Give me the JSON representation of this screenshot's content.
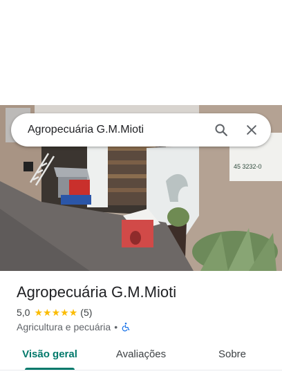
{
  "search": {
    "value": "Agropecuária G.M.Mioti",
    "icons": [
      "search-icon",
      "close-icon"
    ]
  },
  "photo": {
    "sign_text": "45 3232-0"
  },
  "place": {
    "name": "Agropecuária G.M.Mioti",
    "rating": "5,0",
    "stars": 5,
    "review_count": "(5)",
    "category": "Agricultura e pecuária",
    "separator": "•",
    "accessibility_icon": "wheelchair-icon"
  },
  "tabs": [
    {
      "label": "Visão geral",
      "active": true
    },
    {
      "label": "Avaliações",
      "active": false
    },
    {
      "label": "Sobre",
      "active": false
    }
  ],
  "colors": {
    "accent": "#00796b",
    "star": "#fbbc04",
    "accessibility": "#1a73e8"
  }
}
